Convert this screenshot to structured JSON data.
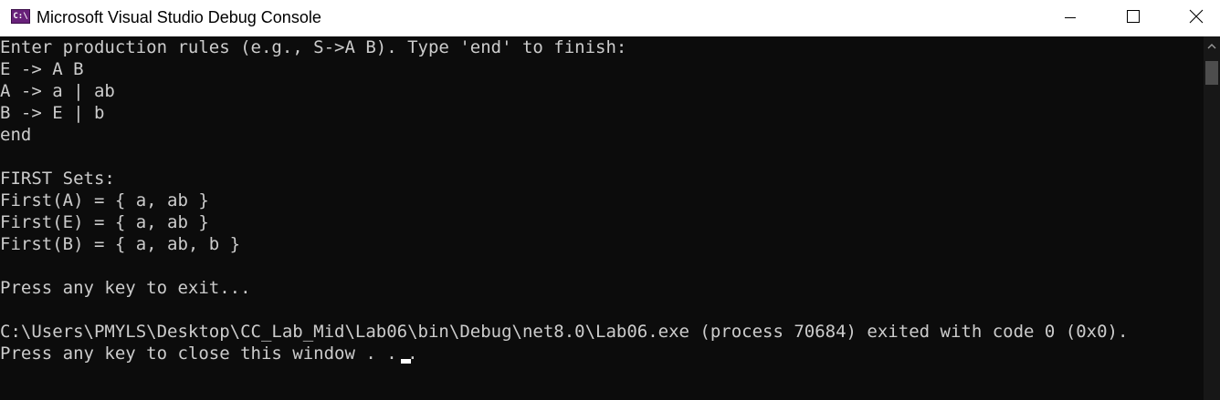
{
  "window": {
    "title": "Microsoft Visual Studio Debug Console",
    "icon_label": "C:\\",
    "icon": "visual-studio-console-icon",
    "controls": {
      "minimize_icon": "minimize-icon",
      "maximize_icon": "maximize-icon",
      "close_icon": "close-icon"
    }
  },
  "colors": {
    "console_background": "#0c0c0c",
    "console_text": "#cccccc",
    "titlebar_background": "#ffffff",
    "icon_accent": "#68217a"
  },
  "console": {
    "lines": [
      "Enter production rules (e.g., S->A B). Type 'end' to finish:",
      "E -> A B",
      "A -> a | ab",
      "B -> E | b",
      "end",
      "",
      "FIRST Sets:",
      "First(A) = { a, ab }",
      "First(E) = { a, ab }",
      "First(B) = { a, ab, b }",
      "",
      "Press any key to exit...",
      "",
      "C:\\Users\\PMYLS\\Desktop\\CC_Lab_Mid\\Lab06\\bin\\Debug\\net8.0\\Lab06.exe (process 70684) exited with code 0 (0x0).",
      "Press any key to close this window . . ."
    ]
  },
  "scrollbar": {
    "up_icon": "scroll-up-arrow-icon"
  }
}
